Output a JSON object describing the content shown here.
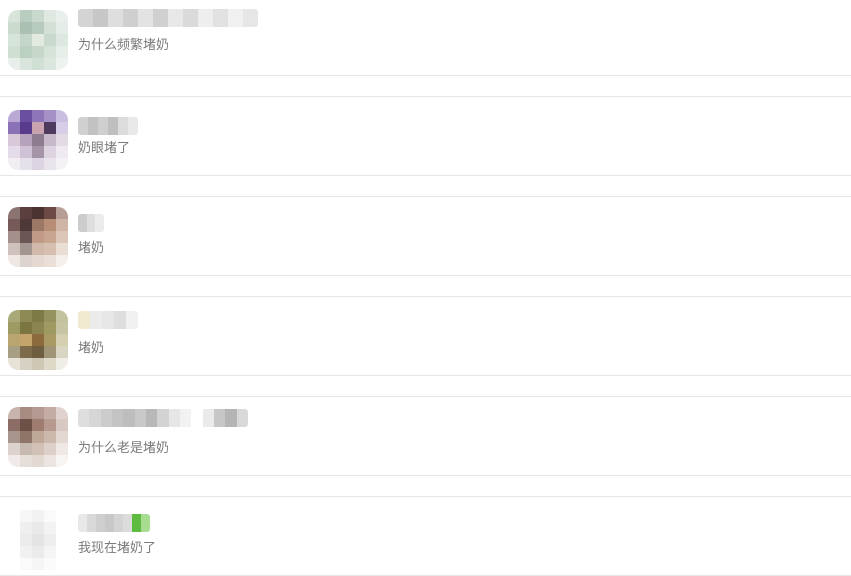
{
  "conversations": [
    {
      "message": "为什么频繁堵奶",
      "avatar_colors": [
        "#d8e4da",
        "#b9ccc0",
        "#c9d8cd",
        "#dfe9e2",
        "#e9f0ec",
        "#cbdccf",
        "#a9c0b2",
        "#b6cbbd",
        "#d2e0d6",
        "#e4ede7",
        "#d7e4da",
        "#c4d6c9",
        "#e3ebe0",
        "#c9d9cd",
        "#dde8e0",
        "#cfe0d3",
        "#bcd0c2",
        "#c7d8cb",
        "#d6e3d9",
        "#e6eee8",
        "#e8efea",
        "#d9e5dc",
        "#cfdfd3",
        "#dbe6de",
        "#eef3ef"
      ],
      "name_colors": [
        "#d4d4d4",
        "#c7c7c7",
        "#dedede",
        "#cfcfcf",
        "#e3e3e3",
        "#d0d0d0",
        "#e8e8e8",
        "#dadada",
        "#eeeeee",
        "#e1e1e1",
        "#f0f0f0",
        "#e6e6e6"
      ]
    },
    {
      "message": "奶眼堵了",
      "avatar_colors": [
        "#b9a9d4",
        "#6a4fa0",
        "#8e74b8",
        "#a591c6",
        "#c9bedf",
        "#8b72b6",
        "#5a3a8d",
        "#c9a3b0",
        "#4f3a5e",
        "#d8cde6",
        "#d9c8d8",
        "#b6a2bd",
        "#8d7b8f",
        "#c7b9c9",
        "#e3dae6",
        "#e4dce8",
        "#cfc2d6",
        "#a394a7",
        "#ddd3e1",
        "#efeaf1",
        "#f1edf3",
        "#e6e0ea",
        "#dcd4e0",
        "#e9e3ec",
        "#f5f2f6"
      ],
      "name_colors": [
        "#d0d0d0",
        "#c2c2c2",
        "#cfcfcf",
        "#bfbfbf",
        "#dcdcdc",
        "#e9e9e9"
      ]
    },
    {
      "message": "堵奶",
      "avatar_colors": [
        "#8a7371",
        "#5b3e3e",
        "#4d3232",
        "#6d4a45",
        "#b69d96",
        "#765a57",
        "#4f3838",
        "#9c7867",
        "#b88d75",
        "#cfb5a6",
        "#a48f8a",
        "#6c5555",
        "#c09a86",
        "#c8a58f",
        "#dcc6b8",
        "#cfc2bd",
        "#a39590",
        "#d0b9ab",
        "#d6bfb0",
        "#e9ddd4",
        "#eee7e3",
        "#ddd3cf",
        "#e4d8d0",
        "#eadfd7",
        "#f5efeb"
      ],
      "name_colors": [
        "#cccccc",
        "#dedede",
        "#ebebeb"
      ]
    },
    {
      "message": "堵奶",
      "avatar_colors": [
        "#a8a878",
        "#8e8a55",
        "#7d7a45",
        "#96925f",
        "#c3c29f",
        "#9d9a64",
        "#7b7640",
        "#8a8550",
        "#9e9a62",
        "#c6c4a2",
        "#b9a56f",
        "#c4a46a",
        "#8c6a3c",
        "#a99a63",
        "#d4cfae",
        "#a89e84",
        "#7d6a4b",
        "#6f5d40",
        "#a09576",
        "#d9d5c3",
        "#e6e3d6",
        "#d6d1c2",
        "#cec7b3",
        "#ddd8c8",
        "#efede5"
      ],
      "name_colors": [
        "#f1ead0",
        "#ebebeb",
        "#e6e6e6",
        "#dedede",
        "#f0f0f0"
      ]
    },
    {
      "message": "为什么老是堵奶",
      "avatar_colors": [
        "#c9b4ad",
        "#a88c84",
        "#b39992",
        "#c4aca5",
        "#e0d3cf",
        "#8c6d66",
        "#6d5048",
        "#9e7c70",
        "#b69a8f",
        "#d8c8c2",
        "#a8958d",
        "#8f7568",
        "#c0a898",
        "#cdb8ad",
        "#e3d8d2",
        "#ddd2cc",
        "#c7b8b0",
        "#d1c1b7",
        "#ddd0c8",
        "#efe8e4",
        "#f0ebe8",
        "#e6ded9",
        "#e3d9d3",
        "#ebe4e0",
        "#f7f4f2"
      ],
      "name_colors": [
        "#dedede",
        "#d6d6d6",
        "#cccccc",
        "#c4c4c4",
        "#bdbdbd",
        "#c9c9c9",
        "#b8b8b8",
        "#d3d3d3",
        "#e6e6e6",
        "#f2f2f2",
        "#ffffff",
        "#eaeaea",
        "#c7c7c7",
        "#b5b5b5",
        "#d9d9d9"
      ]
    },
    {
      "message": "我现在堵奶了",
      "avatar_colors": [
        "#ffffff",
        "#f7f7f7",
        "#f2f2f2",
        "#fafafa",
        "#ffffff",
        "#ffffff",
        "#efefef",
        "#e9e9e9",
        "#f3f3f3",
        "#ffffff",
        "#ffffff",
        "#ececec",
        "#e4e4e4",
        "#eeeeee",
        "#ffffff",
        "#ffffff",
        "#f1f1f1",
        "#ebebeb",
        "#f5f5f5",
        "#ffffff",
        "#ffffff",
        "#fafafa",
        "#f6f6f6",
        "#fbfbfb",
        "#ffffff"
      ],
      "name_colors": [
        "#e8e8e8",
        "#d9d9d9",
        "#cfcfcf",
        "#c8c8c8",
        "#d4d4d4",
        "#dcdcdc",
        "#5dbb3f",
        "#a8dc90"
      ]
    }
  ]
}
